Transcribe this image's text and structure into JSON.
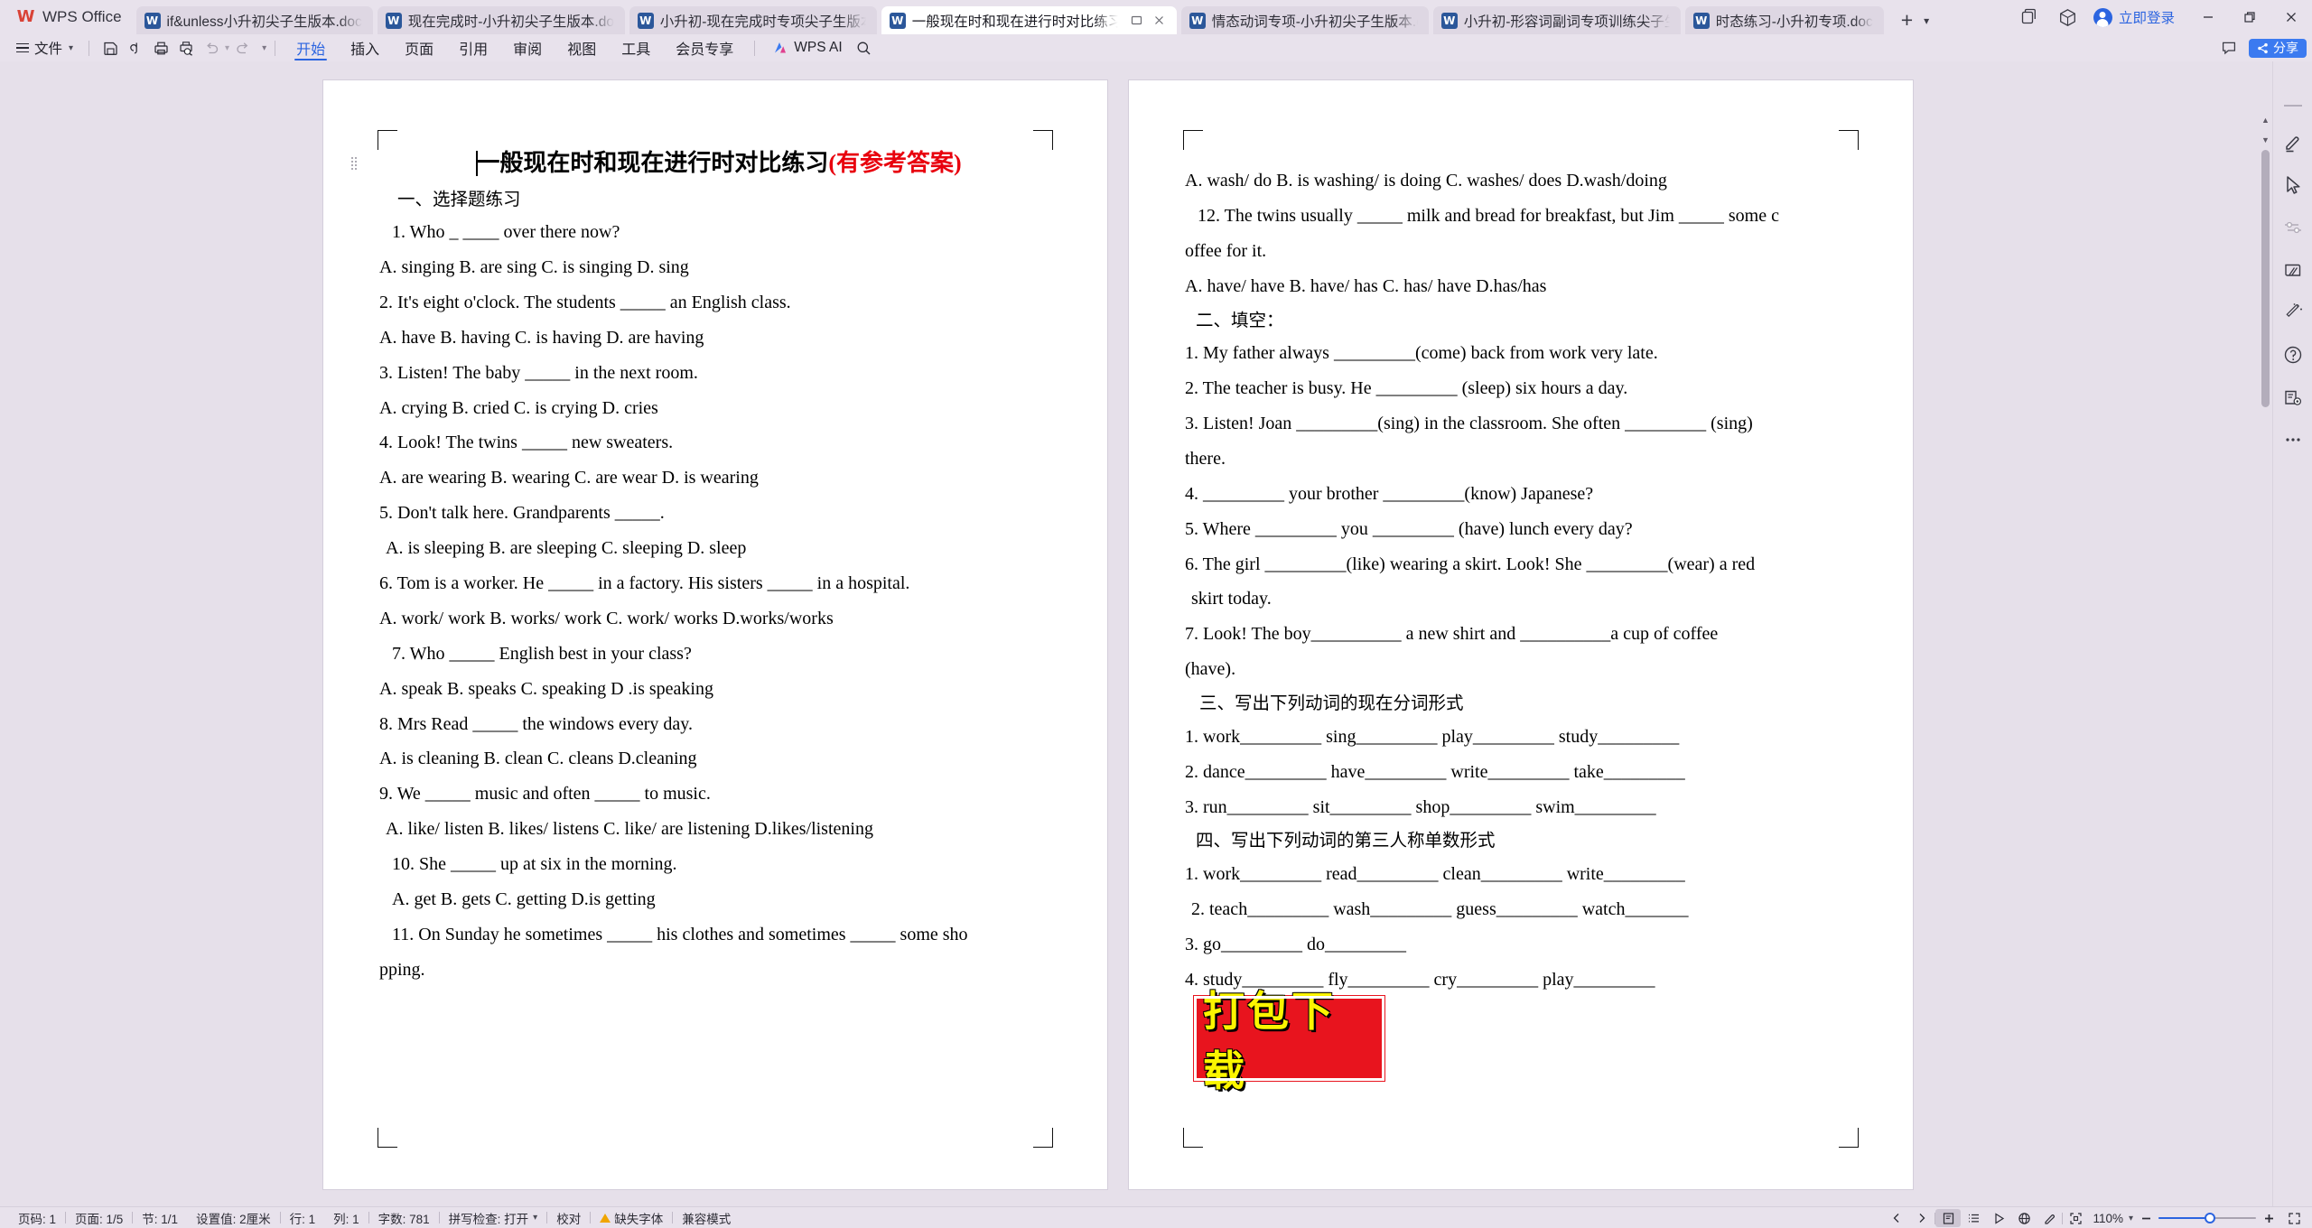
{
  "app": {
    "name": "WPS Office",
    "login_label": "立即登录"
  },
  "tabs": [
    {
      "label": "if&unless小升初尖子生版本.doc",
      "active": false
    },
    {
      "label": "现在完成时-小升初尖子生版本.doc",
      "active": false
    },
    {
      "label": "小升初-现在完成时专项尖子生版本.doc",
      "active": false
    },
    {
      "label": "一般现在时和现在进行时对比练习-小升初专项.doc",
      "active": true
    },
    {
      "label": "情态动词专项-小升初尖子生版本.doc",
      "active": false
    },
    {
      "label": "小升初-形容词副词专项训练尖子生版本.doc",
      "active": false
    },
    {
      "label": "时态练习-小升初专项.doc",
      "active": false
    }
  ],
  "ribbon": {
    "file_label": "文件",
    "menus": [
      {
        "label": "开始",
        "selected": true
      },
      {
        "label": "插入",
        "selected": false
      },
      {
        "label": "页面",
        "selected": false
      },
      {
        "label": "引用",
        "selected": false
      },
      {
        "label": "审阅",
        "selected": false
      },
      {
        "label": "视图",
        "selected": false
      },
      {
        "label": "工具",
        "selected": false
      },
      {
        "label": "会员专享",
        "selected": false
      }
    ],
    "ai_label": "WPS AI",
    "share_label": "分享"
  },
  "document": {
    "title_black": "一般现在时和现在进行时对比练习",
    "title_red": "(有参考答案)",
    "left_page": {
      "section1": "一、选择题练习",
      "lines": [
        {
          "text": "1. Who _ ____ over there now?",
          "indent": "ind"
        },
        {
          "text": "A. singing   B. are sing   C. is singing   D. sing",
          "indent": ""
        },
        {
          "text": "2. It's eight o'clock. The students _____ an English class.",
          "indent": ""
        },
        {
          "text": "A. have        B. having   C. is having      D. are having",
          "indent": ""
        },
        {
          "text": "3. Listen! The baby _____ in the next room.",
          "indent": ""
        },
        {
          "text": "A. crying      B. cried    C. is crying    D. cries",
          "indent": ""
        },
        {
          "text": "4. Look! The twins _____ new sweaters.",
          "indent": ""
        },
        {
          "text": "A. are wearing   B. wearing          C. are wear   D. is wearing",
          "indent": ""
        },
        {
          "text": "5. Don't talk here. Grandparents _____.",
          "indent": ""
        },
        {
          "text": "A. is sleeping  B. are sleeping   C. sleeping        D. sleep",
          "indent": "ind2"
        },
        {
          "text": "6. Tom is a worker. He _____ in a factory. His sisters _____ in a hospital.",
          "indent": ""
        },
        {
          "text": "A. work/ work   B. works/ work   C. work/ works   D.works/works",
          "indent": ""
        },
        {
          "text": "7. Who _____ English best in your class?",
          "indent": "ind"
        },
        {
          "text": "A. speak           B. speaks                C. speaking     D .is speaking",
          "indent": ""
        },
        {
          "text": "8. Mrs Read _____ the windows every day.",
          "indent": ""
        },
        {
          "text": "A. is cleaning    B. clean          C. cleans               D.cleaning",
          "indent": ""
        },
        {
          "text": "9. We _____ music and often _____ to music.",
          "indent": ""
        },
        {
          "text": "A. like/ listen  B. likes/ listens  C. like/ are listening  D.likes/listening",
          "indent": "ind2"
        },
        {
          "text": "10. She _____ up at six in the morning.",
          "indent": "ind"
        },
        {
          "text": "A. get                B. gets            C. getting                  D.is getting",
          "indent": "ind"
        },
        {
          "text": "11. On Sunday he sometimes _____ his clothes and sometimes _____ some sho",
          "indent": "ind"
        },
        {
          "text": "pping.",
          "indent": ""
        }
      ]
    },
    "right_page": {
      "section2": "二、填空：",
      "section3": "三、写出下列动词的现在分词形式",
      "section4": "四、写出下列动词的第三人称单数形式",
      "lines_top": [
        {
          "text": "A. wash/ do    B. is washing/ is doing   C. washes/ does   D.wash/doing",
          "indent": ""
        },
        {
          "text": "12. The twins usually _____ milk and bread for breakfast, but Jim _____ some c",
          "indent": "ind"
        },
        {
          "text": "offee for it.",
          "indent": ""
        },
        {
          "text": "A. have/ have   B. have/ has                C. has/ have      D.has/has",
          "indent": ""
        }
      ],
      "lines_fill": [
        {
          "text": "1. My father always _________(come) back from work very late.",
          "indent": ""
        },
        {
          "text": "2. The teacher is busy. He _________ (sleep) six hours a day.",
          "indent": ""
        },
        {
          "text": "3. Listen! Joan _________(sing) in the classroom. She often _________ (sing)",
          "indent": ""
        },
        {
          "text": "there.",
          "indent": ""
        },
        {
          "text": "4. _________ your brother _________(know) Japanese?",
          "indent": ""
        },
        {
          "text": "5. Where _________ you _________ (have) lunch every day?",
          "indent": ""
        },
        {
          "text": "6. The girl _________(like) wearing a skirt. Look! She _________(wear) a red",
          "indent": ""
        },
        {
          "text": "skirt today.",
          "indent": "ind2"
        },
        {
          "text": "7. Look! The boy__________  a new shirt and  __________a cup of coffee",
          "indent": ""
        },
        {
          "text": "(have).",
          "indent": ""
        }
      ],
      "lines_sec3": [
        {
          "text": "1. work_________   sing_________   play_________   study_________",
          "indent": ""
        },
        {
          "text": "2. dance_________    have_________    write_________    take_________",
          "indent": ""
        },
        {
          "text": "3. run_________      sit_________     shop_________     swim_________",
          "indent": ""
        }
      ],
      "lines_sec4": [
        {
          "text": "1. work_________     read_________    clean_________    write_________",
          "indent": ""
        },
        {
          "text": "2. teach_________      wash_________     guess_________     watch_______",
          "indent": "ind2"
        },
        {
          "text": "3. go_________      do_________",
          "indent": ""
        },
        {
          "text": "4. study_________     fly_________      cry_________     play_________",
          "indent": ""
        }
      ]
    }
  },
  "watermark": {
    "text": "打包下载"
  },
  "statusbar": {
    "items": [
      "页码: 1",
      "页面: 1/5",
      "节: 1/1",
      "设置值: 2厘米",
      "行: 1",
      "列: 1",
      "字数: 781",
      "拼写检查: 打开",
      "校对",
      "缺失字体",
      "兼容模式"
    ],
    "zoom": "110%"
  }
}
